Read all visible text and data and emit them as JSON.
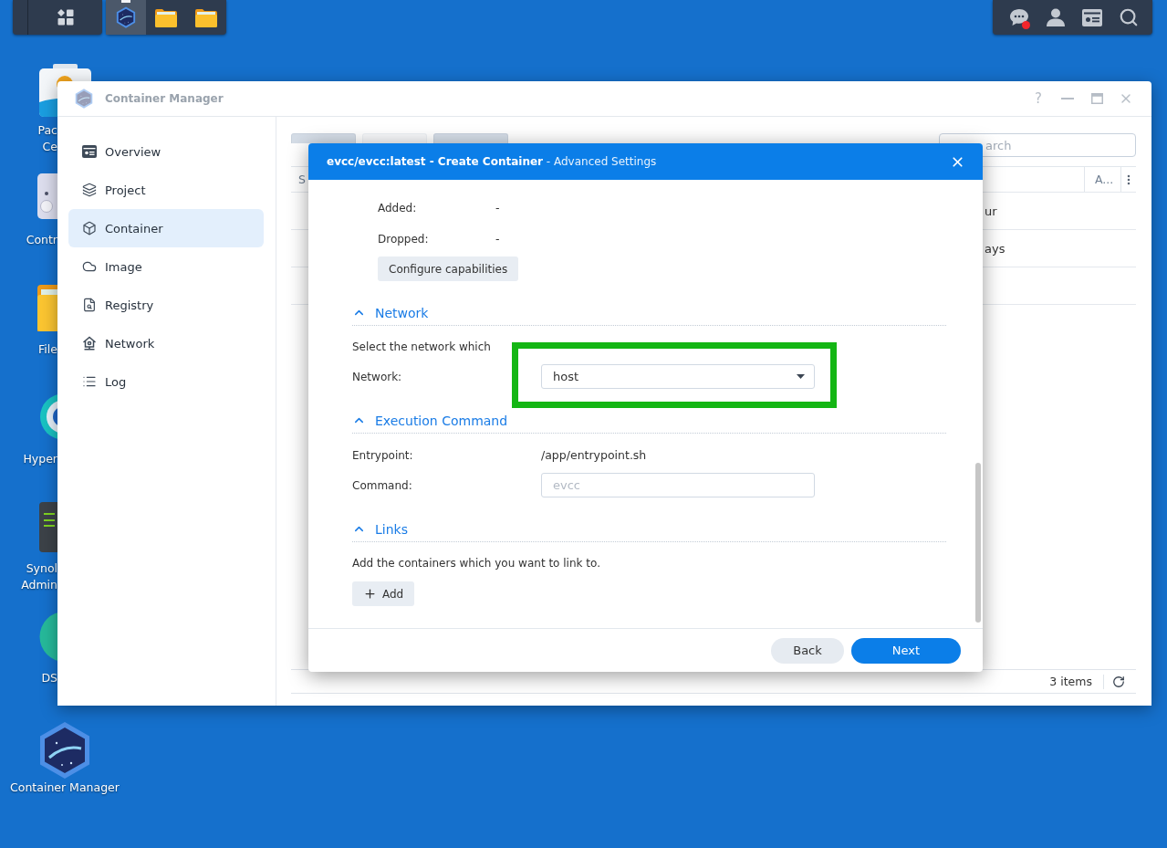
{
  "taskbar": {
    "apps": [
      {
        "kind": "container",
        "active": true
      },
      {
        "kind": "folder",
        "active": false
      },
      {
        "kind": "folder",
        "active": false
      }
    ],
    "tray": [
      {
        "kind": "chat",
        "badge": true
      },
      {
        "kind": "user",
        "badge": false
      },
      {
        "kind": "widgets",
        "badge": false
      },
      {
        "kind": "search",
        "badge": false
      }
    ]
  },
  "desktop_icons": [
    {
      "kind": "package",
      "lines": [
        "Pac",
        "Ce"
      ]
    },
    {
      "kind": "panel",
      "lines": [
        "Contr"
      ]
    },
    {
      "kind": "folder",
      "lines": [
        "File"
      ]
    },
    {
      "kind": "backup",
      "lines": [
        "Hyper"
      ]
    },
    {
      "kind": "server",
      "lines": [
        "Synol",
        "Admin"
      ]
    },
    {
      "kind": "dsm",
      "lines": [
        "DS"
      ]
    },
    {
      "kind": "container",
      "lines": [
        "Container Manager"
      ]
    }
  ],
  "window": {
    "title": "Container Manager",
    "help": "?",
    "sidebar": [
      {
        "kind": "card",
        "label": "Overview",
        "selected": false
      },
      {
        "kind": "layers",
        "label": "Project",
        "selected": false
      },
      {
        "kind": "cube",
        "label": "Container",
        "selected": true
      },
      {
        "kind": "cloud",
        "label": "Image",
        "selected": false
      },
      {
        "kind": "search",
        "label": "Registry",
        "selected": false
      },
      {
        "kind": "house",
        "label": "Network",
        "selected": false
      },
      {
        "kind": "list",
        "label": "Log",
        "selected": false
      }
    ],
    "toolbar": [
      {
        "disabled": false
      },
      {
        "disabled": true
      },
      {
        "disabled": false
      }
    ],
    "search": {
      "placeholder": "arch"
    },
    "table": {
      "columns": [
        {
          "label": "S"
        },
        {
          "label": "A..."
        }
      ],
      "rows": [
        {
          "kind": "text",
          "cell": "ur"
        },
        {
          "kind": "text",
          "cell": "ays"
        },
        {
          "kind": "blank"
        }
      ]
    },
    "footer": {
      "count": "3 items"
    }
  },
  "dialog": {
    "title": "**evcc/evcc:latest - Create Container** - Advanced Settings",
    "capabilities": [
      {
        "label": "Added:",
        "value": "-"
      },
      {
        "label": "Dropped:",
        "value": "-"
      }
    ],
    "capabilities_button": "Configure capabilities",
    "sections": [
      {
        "title": "Network",
        "expanded": true,
        "description": "Select the network which",
        "fields": [
          {
            "kind": "select",
            "label": "Network:",
            "value": "host",
            "highlighted": true
          }
        ]
      },
      {
        "title": "Execution Command",
        "expanded": true,
        "fields": [
          {
            "kind": "text",
            "label": "Entrypoint:",
            "value": "/app/entrypoint.sh",
            "highlighted": false
          },
          {
            "kind": "input",
            "label": "Command:",
            "placeholder": "evcc",
            "highlighted": false
          }
        ]
      },
      {
        "title": "Links",
        "expanded": true,
        "description": "Add the containers which you want to link to.",
        "button": "Add"
      }
    ],
    "buttons": [
      {
        "label": "Back",
        "primary": false
      },
      {
        "label": "Next",
        "primary": true
      }
    ]
  }
}
